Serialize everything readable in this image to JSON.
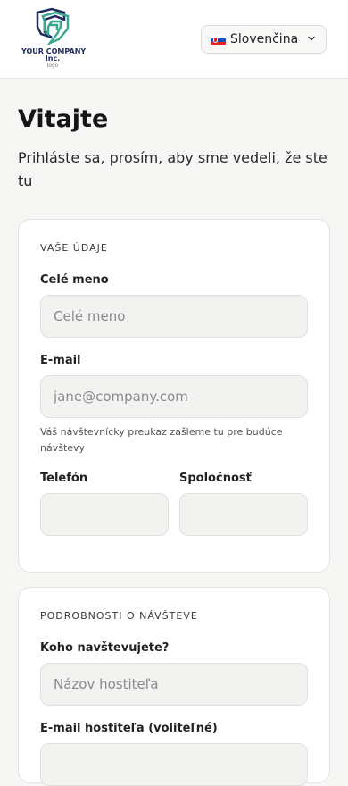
{
  "header": {
    "logo": {
      "line1": "YOUR COMPANY",
      "line2": "Inc.",
      "line3": "logo"
    },
    "language": {
      "selected": "Slovenčina",
      "flag_icon": "slovakia-flag-icon"
    }
  },
  "page": {
    "title": "Vitajte",
    "subtitle": "Prihláste sa, prosím, aby sme vedeli, že ste tu"
  },
  "details": {
    "heading": "VAŠE ÚDAJE",
    "full_name": {
      "label": "Celé meno",
      "placeholder": "Celé meno"
    },
    "email": {
      "label": "E-mail",
      "placeholder": "jane@company.com",
      "hint": "Váš návštevnícky preukaz zašleme tu pre budúce návštevy"
    },
    "phone": {
      "label": "Telefón",
      "placeholder": ""
    },
    "company": {
      "label": "Spoločnosť",
      "placeholder": ""
    }
  },
  "visit": {
    "heading": "PODROBNOSTI O NÁVŠTEVE",
    "host": {
      "label": "Koho navštevujete?",
      "placeholder": "Názov hostiteľa"
    },
    "host_email": {
      "label": "E-mail hostiteľa (voliteľné)",
      "placeholder": ""
    }
  },
  "colors": {
    "background": "#f6f6f4",
    "card": "#ffffff",
    "input": "#f2f2f0",
    "logo_teal": "#3aa88f",
    "logo_navy": "#1d2c5c"
  }
}
